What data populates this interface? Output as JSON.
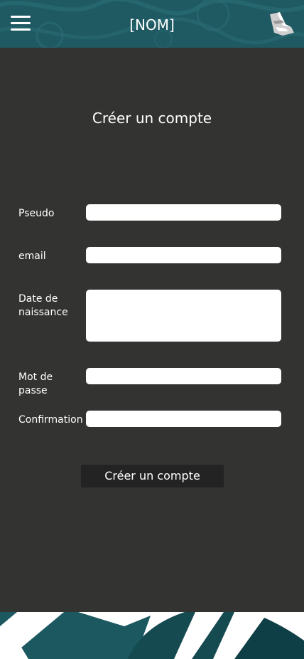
{
  "header": {
    "title": "[NOM]",
    "menu_icon": "hamburger-menu-icon",
    "logo_icon": "brand-logo-icon"
  },
  "form": {
    "title": "Créer un compte",
    "fields": [
      {
        "label": "Pseudo",
        "value": ""
      },
      {
        "label": "email",
        "value": ""
      },
      {
        "label": "Date de naissance",
        "value": ""
      },
      {
        "label": "Mot de passe",
        "value": ""
      },
      {
        "label": "Confirmation",
        "value": ""
      }
    ],
    "submit_label": "Créer un compte"
  },
  "colors": {
    "header_bg": "#1f5a62",
    "main_bg": "#333331",
    "button_bg": "#232323",
    "footer_accent": "#1c5860"
  }
}
